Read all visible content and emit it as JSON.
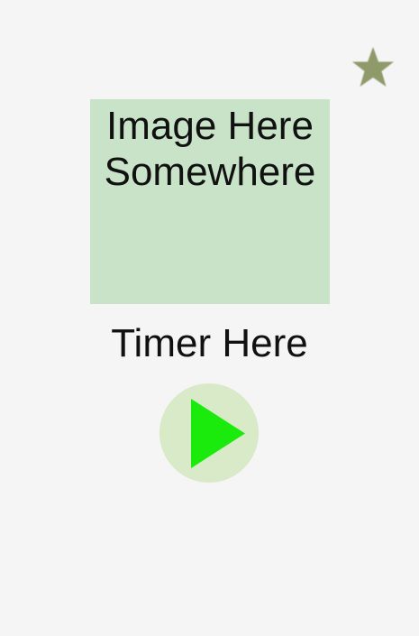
{
  "favorite": {
    "icon": "star-icon",
    "color": "#8f9a6a"
  },
  "image_placeholder": {
    "line1": "Image Here",
    "line2": "Somewhere",
    "background": "#c8e3c8"
  },
  "timer": {
    "label": "Timer Here"
  },
  "play_button": {
    "icon": "play-icon",
    "icon_color": "#1aeb0c",
    "background": "#d8eac8"
  }
}
